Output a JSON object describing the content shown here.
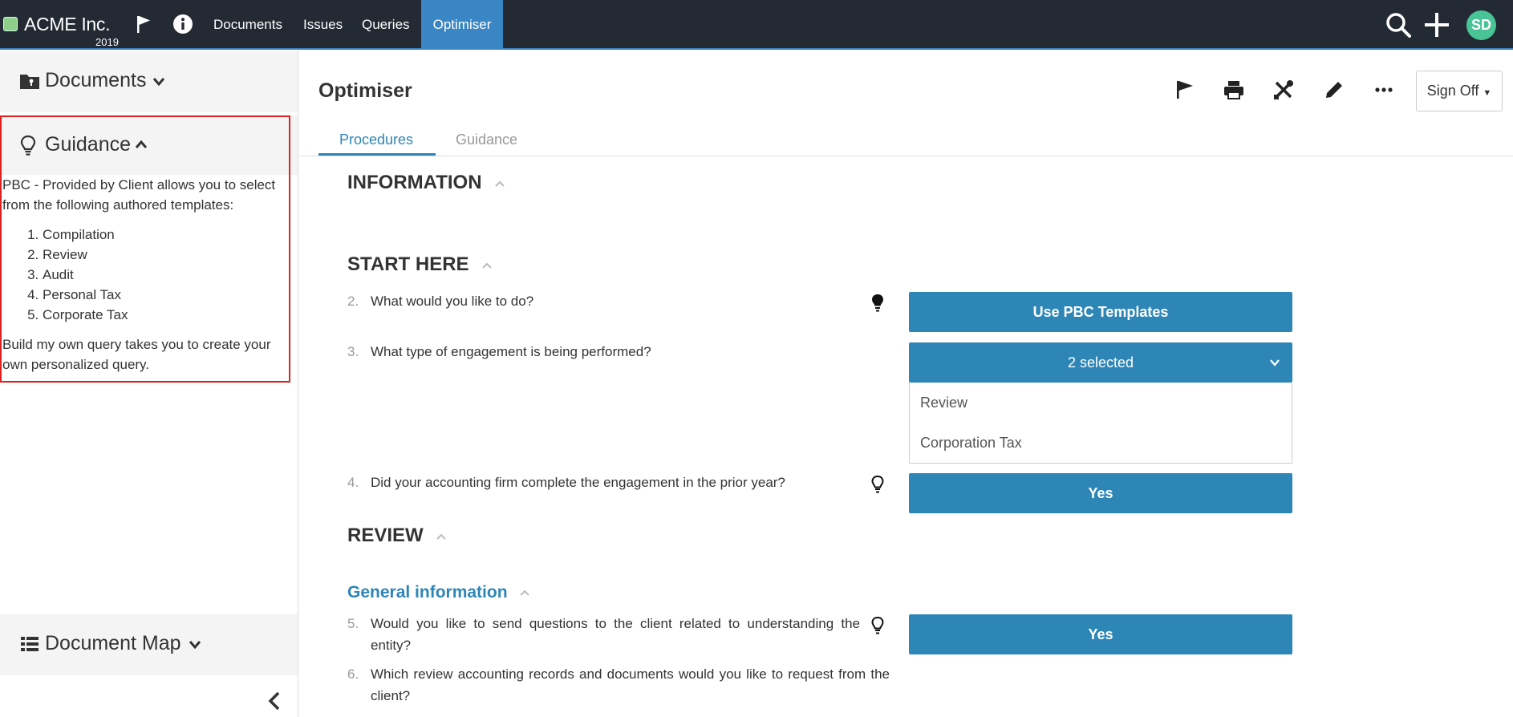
{
  "topbar": {
    "brand": "ACME Inc.",
    "year": "2019",
    "nav": [
      {
        "label": "Documents"
      },
      {
        "label": "Issues"
      },
      {
        "label": "Queries"
      },
      {
        "label": "Optimiser"
      }
    ],
    "avatar_initials": "SD",
    "colors": {
      "bar": "#232a33",
      "active": "#3a86c4",
      "avatar": "#49c497"
    }
  },
  "sidebar": {
    "documents_label": "Documents",
    "guidance_label": "Guidance",
    "guidance_intro": "PBC - Provided by Client allows you to select from the following authored templates:",
    "guidance_items": [
      "Compilation",
      "Review",
      "Audit",
      "Personal Tax",
      "Corporate Tax"
    ],
    "guidance_outro": "Build my own query takes you to create your own personalized query.",
    "document_map_label": "Document Map"
  },
  "main": {
    "title": "Optimiser",
    "signoff_label": "Sign Off",
    "tabs": [
      {
        "label": "Procedures"
      },
      {
        "label": "Guidance"
      }
    ],
    "sections": {
      "information": "INFORMATION",
      "start_here": "START HERE",
      "review": "REVIEW",
      "general_information": "General information"
    },
    "questions": [
      {
        "num": "2.",
        "text": "What would you like to do?",
        "answer": "Use PBC Templates"
      },
      {
        "num": "3.",
        "text": "What type of engagement is being performed?",
        "answer": "2 selected",
        "options": [
          "Review",
          "Corporation Tax"
        ]
      },
      {
        "num": "4.",
        "text": "Did your accounting firm complete the engagement in the prior year?",
        "answer": "Yes"
      },
      {
        "num": "5.",
        "text": "Would you like to send questions to the client related to understanding the entity?",
        "answer": "Yes"
      },
      {
        "num": "6.",
        "text": "Which review accounting records and documents would you like to request from the client?"
      }
    ],
    "accent_color": "#2e86b7"
  }
}
